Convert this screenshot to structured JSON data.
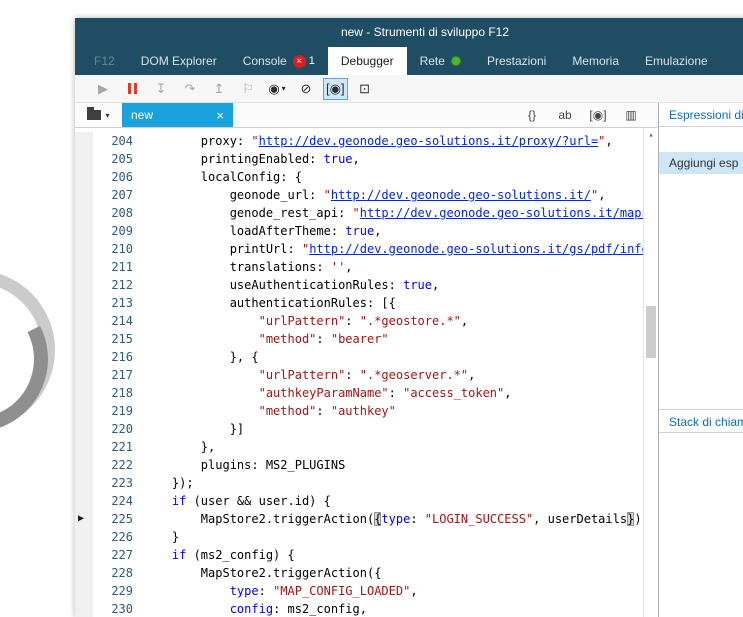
{
  "window": {
    "title": "new - Strumenti di sviluppo F12"
  },
  "colors": {
    "titlebar_bg": "#1f4d63",
    "active_tab_bg": "#ffffff",
    "file_tab_blue": "#19a2dd",
    "error_badge_red": "#dd1c1c",
    "network_dot_green": "#4db82d",
    "string_red": "#a31515",
    "keyword_blue": "#0000ff",
    "link_blue": "#0026e8",
    "panel_header_blue": "#0e6eb8",
    "add_row_bg": "#cde7f7"
  },
  "menu": {
    "items": [
      {
        "id": "f12",
        "label": "F12",
        "muted": true
      },
      {
        "id": "dom-explorer",
        "label": "DOM Explorer"
      },
      {
        "id": "console",
        "label": "Console",
        "badge_count": "1"
      },
      {
        "id": "debugger",
        "label": "Debugger",
        "active": true
      },
      {
        "id": "rete",
        "label": "Rete",
        "dot": true
      },
      {
        "id": "prestazioni",
        "label": "Prestazioni"
      },
      {
        "id": "memoria",
        "label": "Memoria"
      },
      {
        "id": "emulazione",
        "label": "Emulazione"
      }
    ]
  },
  "toolbar": {
    "icons": [
      {
        "id": "continue",
        "glyph": "▶",
        "cls": "disabled"
      },
      {
        "id": "break-all",
        "glyph": "",
        "cls": "pause"
      },
      {
        "id": "step-into",
        "glyph": "↧",
        "cls": "disabled"
      },
      {
        "id": "step-over",
        "glyph": "↷",
        "cls": "disabled"
      },
      {
        "id": "step-out",
        "glyph": "↥",
        "cls": "disabled"
      },
      {
        "id": "break-on-exception",
        "glyph": "⚐",
        "cls": "disabled"
      },
      {
        "id": "exception-settings",
        "glyph": "◉",
        "cls": "",
        "caret": true
      },
      {
        "id": "disable-breakpoints",
        "glyph": "⊘",
        "cls": ""
      },
      {
        "id": "worker-debugging",
        "glyph": "[◉]",
        "cls": "selected"
      },
      {
        "id": "just-my-code",
        "glyph": "⊡",
        "cls": ""
      }
    ]
  },
  "filetabs": {
    "source_label": "new",
    "close_glyph": "×",
    "strip_icons": [
      {
        "id": "format-code",
        "glyph": "{}"
      },
      {
        "id": "word-wrap",
        "glyph": "ab"
      },
      {
        "id": "just-my-code-toggle",
        "glyph": "[◉]"
      },
      {
        "id": "show-columns",
        "glyph": "▥"
      }
    ]
  },
  "editor": {
    "current_line": 225,
    "lines": [
      {
        "n": 204,
        "t": [
          [
            "p",
            "        proxy: "
          ],
          [
            "s",
            "\""
          ],
          [
            "u",
            "http://dev.geonode.geo-solutions.it/proxy/?url="
          ],
          [
            "s",
            "\""
          ],
          [
            "p",
            ","
          ]
        ]
      },
      {
        "n": 205,
        "t": [
          [
            "p",
            "        printingEnabled: "
          ],
          [
            "k",
            "true"
          ],
          [
            "p",
            ","
          ]
        ]
      },
      {
        "n": 206,
        "t": [
          [
            "p",
            "        localConfig: {"
          ]
        ]
      },
      {
        "n": 207,
        "t": [
          [
            "p",
            "            geonode_url: "
          ],
          [
            "s",
            "\""
          ],
          [
            "u",
            "http://dev.geonode.geo-solutions.it/"
          ],
          [
            "s",
            "\""
          ],
          [
            "p",
            ","
          ]
        ]
      },
      {
        "n": 208,
        "t": [
          [
            "p",
            "            genode_rest_api: "
          ],
          [
            "s",
            "\""
          ],
          [
            "u",
            "http://dev.geonode.geo-solutions.it/mapstore"
          ]
        ]
      },
      {
        "n": 209,
        "t": [
          [
            "p",
            "            loadAfterTheme: "
          ],
          [
            "k",
            "true"
          ],
          [
            "p",
            ","
          ]
        ]
      },
      {
        "n": 210,
        "t": [
          [
            "p",
            "            printUrl: "
          ],
          [
            "s",
            "\""
          ],
          [
            "u",
            "http://dev.geonode.geo-solutions.it/gs/pdf/info.jso"
          ]
        ]
      },
      {
        "n": 211,
        "t": [
          [
            "p",
            "            translations: "
          ],
          [
            "s",
            "''"
          ],
          [
            "p",
            ","
          ]
        ]
      },
      {
        "n": 212,
        "t": [
          [
            "p",
            "            useAuthenticationRules: "
          ],
          [
            "k",
            "true"
          ],
          [
            "p",
            ","
          ]
        ]
      },
      {
        "n": 213,
        "t": [
          [
            "p",
            "            authenticationRules: [{"
          ]
        ]
      },
      {
        "n": 214,
        "t": [
          [
            "p",
            "                "
          ],
          [
            "s",
            "\"urlPattern\""
          ],
          [
            "p",
            ": "
          ],
          [
            "s",
            "\".*geostore.*\""
          ],
          [
            "p",
            ","
          ]
        ]
      },
      {
        "n": 215,
        "t": [
          [
            "p",
            "                "
          ],
          [
            "s",
            "\"method\""
          ],
          [
            "p",
            ": "
          ],
          [
            "s",
            "\"bearer\""
          ]
        ]
      },
      {
        "n": 216,
        "t": [
          [
            "p",
            "            }, {"
          ]
        ]
      },
      {
        "n": 217,
        "t": [
          [
            "p",
            "                "
          ],
          [
            "s",
            "\"urlPattern\""
          ],
          [
            "p",
            ": "
          ],
          [
            "s",
            "\".*geoserver.*\""
          ],
          [
            "p",
            ","
          ]
        ]
      },
      {
        "n": 218,
        "t": [
          [
            "p",
            "                "
          ],
          [
            "s",
            "\"authkeyParamName\""
          ],
          [
            "p",
            ": "
          ],
          [
            "s",
            "\"access_token\""
          ],
          [
            "p",
            ","
          ]
        ]
      },
      {
        "n": 219,
        "t": [
          [
            "p",
            "                "
          ],
          [
            "s",
            "\"method\""
          ],
          [
            "p",
            ": "
          ],
          [
            "s",
            "\"authkey\""
          ]
        ]
      },
      {
        "n": 220,
        "t": [
          [
            "p",
            "            }]"
          ]
        ]
      },
      {
        "n": 221,
        "t": [
          [
            "p",
            "        },"
          ]
        ]
      },
      {
        "n": 222,
        "t": [
          [
            "p",
            "        plugins: MS2_PLUGINS"
          ]
        ]
      },
      {
        "n": 223,
        "t": [
          [
            "p",
            "    });"
          ]
        ]
      },
      {
        "n": 224,
        "t": [
          [
            "p",
            "    "
          ],
          [
            "k",
            "if"
          ],
          [
            "p",
            " (user && user.id) {"
          ]
        ]
      },
      {
        "n": 225,
        "t": [
          [
            "p",
            "        MapStore2.triggerAction("
          ],
          [
            "h",
            "{"
          ],
          [
            "k",
            "type"
          ],
          [
            "p",
            ": "
          ],
          [
            "s",
            "\"LOGIN_SUCCESS\""
          ],
          [
            "p",
            ", userDetails"
          ],
          [
            "h",
            "}"
          ],
          [
            "p",
            ");"
          ]
        ]
      },
      {
        "n": 226,
        "t": [
          [
            "p",
            "    }"
          ]
        ]
      },
      {
        "n": 227,
        "t": [
          [
            "p",
            "    "
          ],
          [
            "k",
            "if"
          ],
          [
            "p",
            " (ms2_config) {"
          ]
        ]
      },
      {
        "n": 228,
        "t": [
          [
            "p",
            "        MapStore2.triggerAction({"
          ]
        ]
      },
      {
        "n": 229,
        "t": [
          [
            "p",
            "            "
          ],
          [
            "k",
            "type"
          ],
          [
            "p",
            ": "
          ],
          [
            "s",
            "\"MAP_CONFIG_LOADED\""
          ],
          [
            "p",
            ","
          ]
        ]
      },
      {
        "n": 230,
        "t": [
          [
            "p",
            "            "
          ],
          [
            "k",
            "config"
          ],
          [
            "p",
            ": ms2_config,"
          ]
        ]
      }
    ]
  },
  "right_panel": {
    "watch_title": "Espressioni di",
    "add_expression_label": "Aggiungi esp",
    "callstack_title": "Stack di chiam",
    "scroll_up_glyph": "▴"
  }
}
